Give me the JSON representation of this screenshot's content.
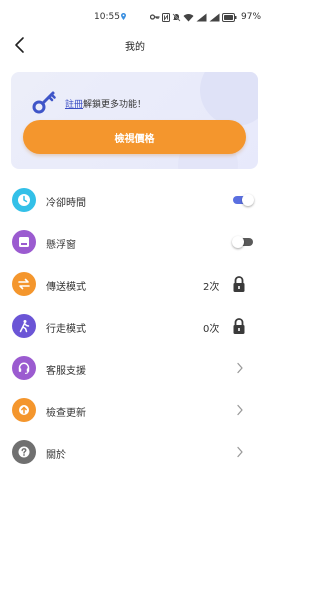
{
  "status_bar": {
    "time": "10:55",
    "battery": "97%"
  },
  "header": {
    "title": "我的"
  },
  "promo": {
    "register_link": "註冊",
    "message": "解鎖更多功能！",
    "button_label": "檢視價格"
  },
  "menu": [
    {
      "id": "cooldown",
      "label": "冷卻時間",
      "icon": "clock-icon",
      "color": "#33c0e8",
      "control": "toggle",
      "enabled": true
    },
    {
      "id": "floating",
      "label": "懸浮窗",
      "icon": "window-icon",
      "color": "#9b5bd0",
      "control": "toggle",
      "enabled": false
    },
    {
      "id": "transfer",
      "label": "傳送模式",
      "icon": "transfer-icon",
      "color": "#f4962d",
      "count": "2次",
      "control": "lock"
    },
    {
      "id": "walk",
      "label": "行走模式",
      "icon": "walk-icon",
      "color": "#6b55d6",
      "count": "0次",
      "control": "lock"
    },
    {
      "id": "support",
      "label": "客服支援",
      "icon": "headset-icon",
      "color": "#9b5bd0",
      "control": "chevron"
    },
    {
      "id": "update",
      "label": "檢查更新",
      "icon": "upload-icon",
      "color": "#f4962d",
      "control": "chevron"
    },
    {
      "id": "about",
      "label": "關於",
      "icon": "question-icon",
      "color": "#707070",
      "control": "chevron"
    }
  ]
}
